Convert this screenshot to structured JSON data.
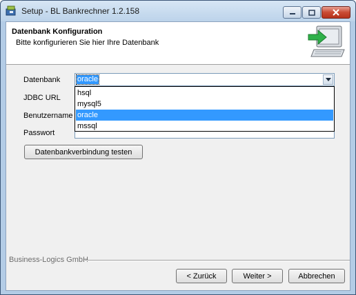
{
  "window": {
    "title": "Setup - BL Bankrechner 1.2.158"
  },
  "header": {
    "title": "Datenbank Konfiguration",
    "subtitle": "Bitte konfigurieren Sie hier Ihre Datenbank"
  },
  "form": {
    "database_label": "Datenbank",
    "database_value": "oracle",
    "database_options": [
      "hsql",
      "mysql5",
      "oracle",
      "mssql"
    ],
    "database_selected_option": "oracle",
    "jdbc_label": "JDBC URL",
    "jdbc_value": "",
    "username_label": "Benutzername",
    "username_value": "",
    "password_label": "Passwort",
    "password_value": "",
    "test_button": "Datenbankverbindung testen"
  },
  "footer": {
    "company": "Business-Logics GmbH",
    "back_button": "< Zurück",
    "next_button": "Weiter >",
    "cancel_button": "Abbrechen"
  },
  "icons": {
    "app": "setup-installer-icon",
    "header": "computer-arrow-icon",
    "dropdown": "chevron-down-icon"
  },
  "colors": {
    "selection": "#3399ff",
    "titlebar": "#bcd3ea",
    "close_button": "#c94a33"
  }
}
